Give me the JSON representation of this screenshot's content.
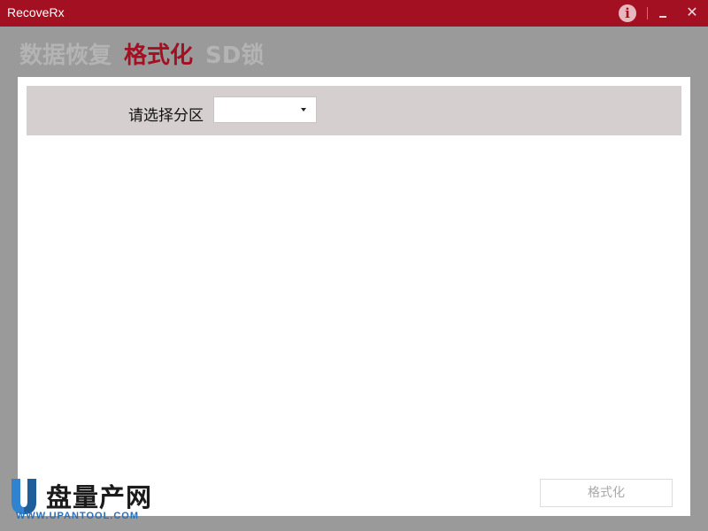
{
  "window": {
    "title": "RecoveRx",
    "info_icon": "info-icon",
    "minimize_icon": "minimize-icon",
    "close_icon": "close-icon",
    "close_glyph": "✕"
  },
  "tabs": [
    {
      "label": "数据恢复"
    },
    {
      "label": "格式化"
    },
    {
      "label": "SD锁"
    }
  ],
  "partition": {
    "label": "请选择分区",
    "selected_value": "",
    "dropdown_icon": "chevron-down-icon"
  },
  "actions": {
    "format_label": "格式化"
  },
  "watermark": {
    "logo_letter": "U",
    "text": "盘量产网",
    "url": "WWW.UPANTOOL.COM"
  },
  "colors": {
    "titlebar": "#a31021",
    "active_tab": "#a31021",
    "inactive_tab": "#b4b4b4",
    "background": "#9a9a9a",
    "partition_bar": "#d5cfcf"
  }
}
